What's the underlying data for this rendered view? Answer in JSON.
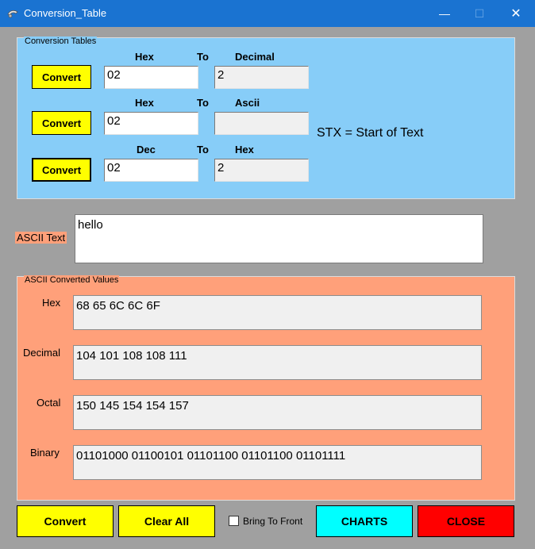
{
  "window": {
    "title": "Conversion_Table",
    "minimize": "—",
    "maximize": "☐",
    "close": "✕"
  },
  "conversion_tables": {
    "group_label": "Conversion Tables",
    "rows": [
      {
        "from_label": "Hex",
        "to_label": "To",
        "target_label": "Decimal",
        "button": "Convert",
        "input": "02",
        "output": "2",
        "note": ""
      },
      {
        "from_label": "Hex",
        "to_label": "To",
        "target_label": "Ascii",
        "button": "Convert",
        "input": "02",
        "output": "",
        "note": "STX = Start of Text"
      },
      {
        "from_label": "Dec",
        "to_label": "To",
        "target_label": "Hex",
        "button": "Convert",
        "input": "02",
        "output": "2",
        "note": ""
      }
    ]
  },
  "ascii_text": {
    "label": "ASCII Text",
    "value": "hello"
  },
  "ascii_converted": {
    "group_label": "ASCII Converted Values",
    "fields": [
      {
        "label": "Hex",
        "value": "68  65  6C  6C  6F"
      },
      {
        "label": "Decimal",
        "value": "104  101  108  108  111"
      },
      {
        "label": "Octal",
        "value": "150  145  154  154  157"
      },
      {
        "label": "Binary",
        "value": "01101000  01100101  01101100  01101100  01101111"
      }
    ]
  },
  "bottom_bar": {
    "convert": "Convert",
    "clear_all": "Clear All",
    "bring_to_front": "Bring To Front",
    "charts": "CHARTS",
    "close": "CLOSE"
  },
  "colors": {
    "titlebar": "#1a73d1",
    "conversion_panel": "#87cdf8",
    "ascii_panel": "#ffa07a",
    "button_yellow": "#ffff00",
    "charts_button": "#00ffff",
    "close_button": "#ff0000"
  }
}
